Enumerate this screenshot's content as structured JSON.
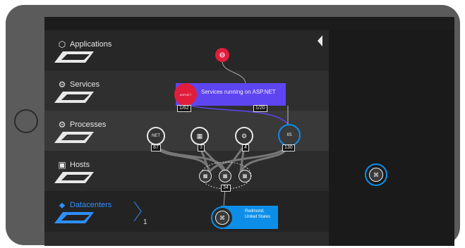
{
  "sidebar": {
    "items": [
      {
        "label": "Applications",
        "icon": "hexagon-icon"
      },
      {
        "label": "Services",
        "icon": "gear-icon"
      },
      {
        "label": "Processes",
        "icon": "processes-icon"
      },
      {
        "label": "Hosts",
        "icon": "host-icon"
      },
      {
        "label": "Datacenters",
        "icon": "datacenter-icon",
        "count": "1"
      }
    ]
  },
  "graph": {
    "service_popup": "Services running on ASP.NET",
    "service_node_label": "ASP.NET",
    "service_badge": "1/62",
    "service_badge_right": "1/20",
    "processes": [
      {
        "label": "NET",
        "badge": "87"
      },
      {
        "label": "win",
        "badge": "3"
      },
      {
        "label": "gear",
        "badge": "4"
      },
      {
        "label": "IIS",
        "badge": "130"
      }
    ],
    "hosts_badge": "34",
    "datacenter_label": "Redmond, United States"
  },
  "colors": {
    "accent_blue": "#0c8ee8",
    "accent_red": "#e01e3c",
    "purple": "#5d45f2"
  }
}
